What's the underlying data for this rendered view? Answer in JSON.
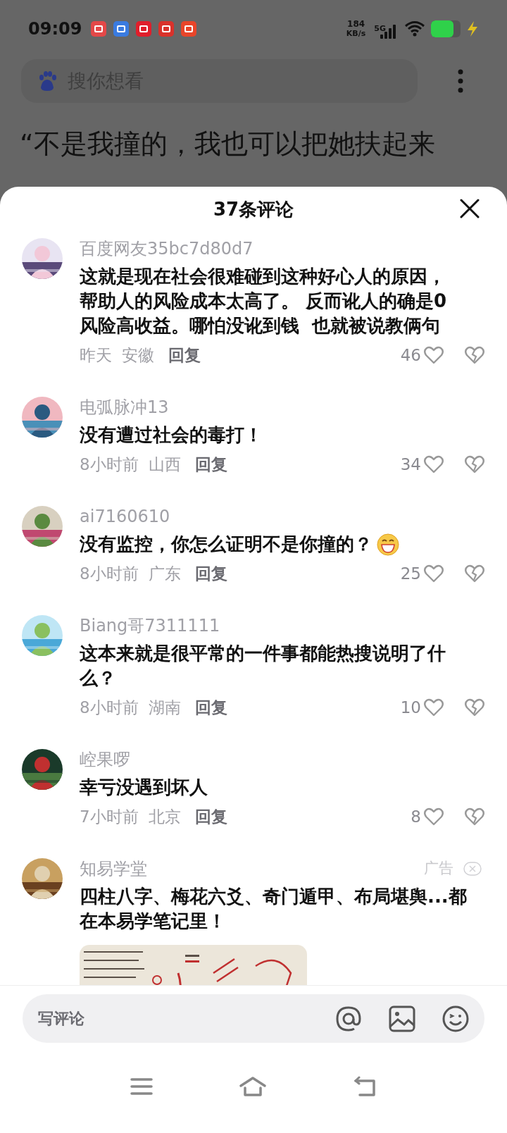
{
  "status_bar": {
    "time": "09:09",
    "net_speed": "184",
    "net_unit": "KB/s",
    "network": "5G"
  },
  "search": {
    "placeholder": "搜你想看"
  },
  "headline": "“不是我撞的，我也可以把她扶起来",
  "sheet": {
    "title": "37条评论"
  },
  "comments": [
    {
      "kind": "comment",
      "user": "百度网友35bc7d80d7",
      "text": "这就是现在社会很难碰到这种好心人的原因，帮助人的风险成本太高了。 反而讹人的确是0风险高收益。哪怕没讹到钱  也就被说教俩句",
      "time": "昨天",
      "location": "安徽",
      "reply": "回复",
      "likes": "46"
    },
    {
      "kind": "comment",
      "user": "电弧脉冲13",
      "text": "没有遭过社会的毒打！",
      "time": "8小时前",
      "location": "山西",
      "reply": "回复",
      "likes": "34"
    },
    {
      "kind": "comment",
      "user": "ai7160610",
      "text": "没有监控，你怎么证明不是你撞的？",
      "emoji": true,
      "time": "8小时前",
      "location": "广东",
      "reply": "回复",
      "likes": "25"
    },
    {
      "kind": "comment",
      "user": "Biang哥7311111",
      "text": "这本来就是很平常的一件事都能热搜说明了什么？",
      "time": "8小时前",
      "location": "湖南",
      "reply": "回复",
      "likes": "10"
    },
    {
      "kind": "comment",
      "user": "崆果啰",
      "text": "幸亏没遇到坏人",
      "time": "7小时前",
      "location": "北京",
      "reply": "回复",
      "likes": "8"
    },
    {
      "kind": "ad",
      "user": "知易学堂",
      "badge": "广告",
      "text": "四柱八字、梅花六爻、奇门遁甲、布局堪舆...都在本易学笔记里！"
    }
  ],
  "composer": {
    "placeholder": "写评论"
  }
}
